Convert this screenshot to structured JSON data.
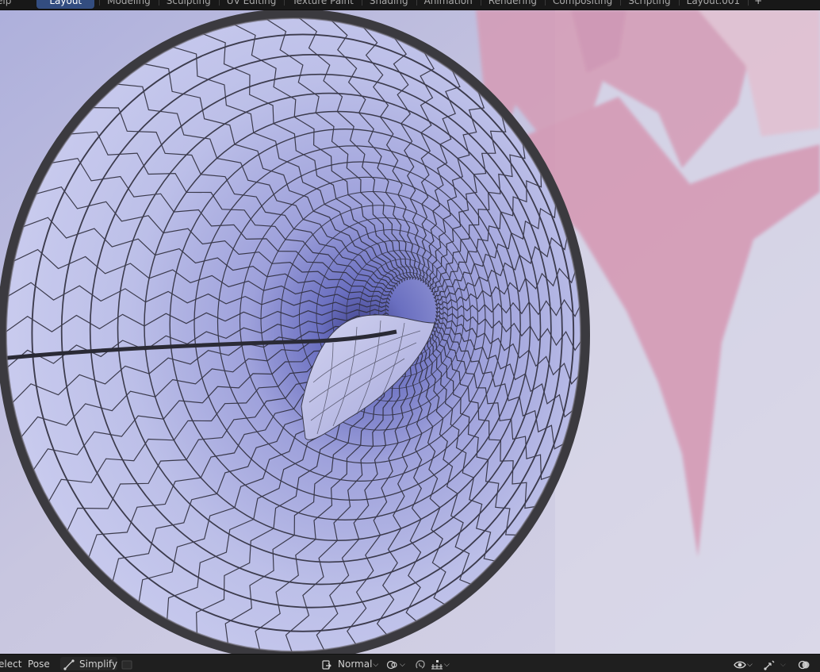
{
  "topbar": {
    "menu_help": "elp",
    "tabs": [
      {
        "label": "Layout",
        "active": true
      },
      {
        "label": "Modeling"
      },
      {
        "label": "Sculpting"
      },
      {
        "label": "UV Editing"
      },
      {
        "label": "Texture Paint"
      },
      {
        "label": "Shading"
      },
      {
        "label": "Animation"
      },
      {
        "label": "Rendering"
      },
      {
        "label": "Compositing"
      },
      {
        "label": "Scripting"
      },
      {
        "label": "Layout.001"
      }
    ],
    "add_tab": "+"
  },
  "bottombar": {
    "select_label": "elect",
    "pose_label": "Pose",
    "simplify_label": "Simplify",
    "orientation_label": "Normal",
    "icons": {
      "simplify": "curve-draw-icon",
      "orientation": "transform-orientation-icon",
      "pivot": "pivot-point-icon",
      "snap": "snap-magnet-icon",
      "snap_target": "snap-increment-icon",
      "visibility": "eye-icon",
      "gizmo": "gizmo-icon",
      "overlays": "overlay-icon"
    }
  },
  "viewport": {
    "scene": "tube-mesh-wireframe",
    "colors": {
      "background": "#c9c6dc",
      "mesh_light": "#b9bbe2",
      "mesh_dark": "#6f74c4",
      "wire": "#2c2b36",
      "pink_shape": "#d49ab4"
    }
  }
}
